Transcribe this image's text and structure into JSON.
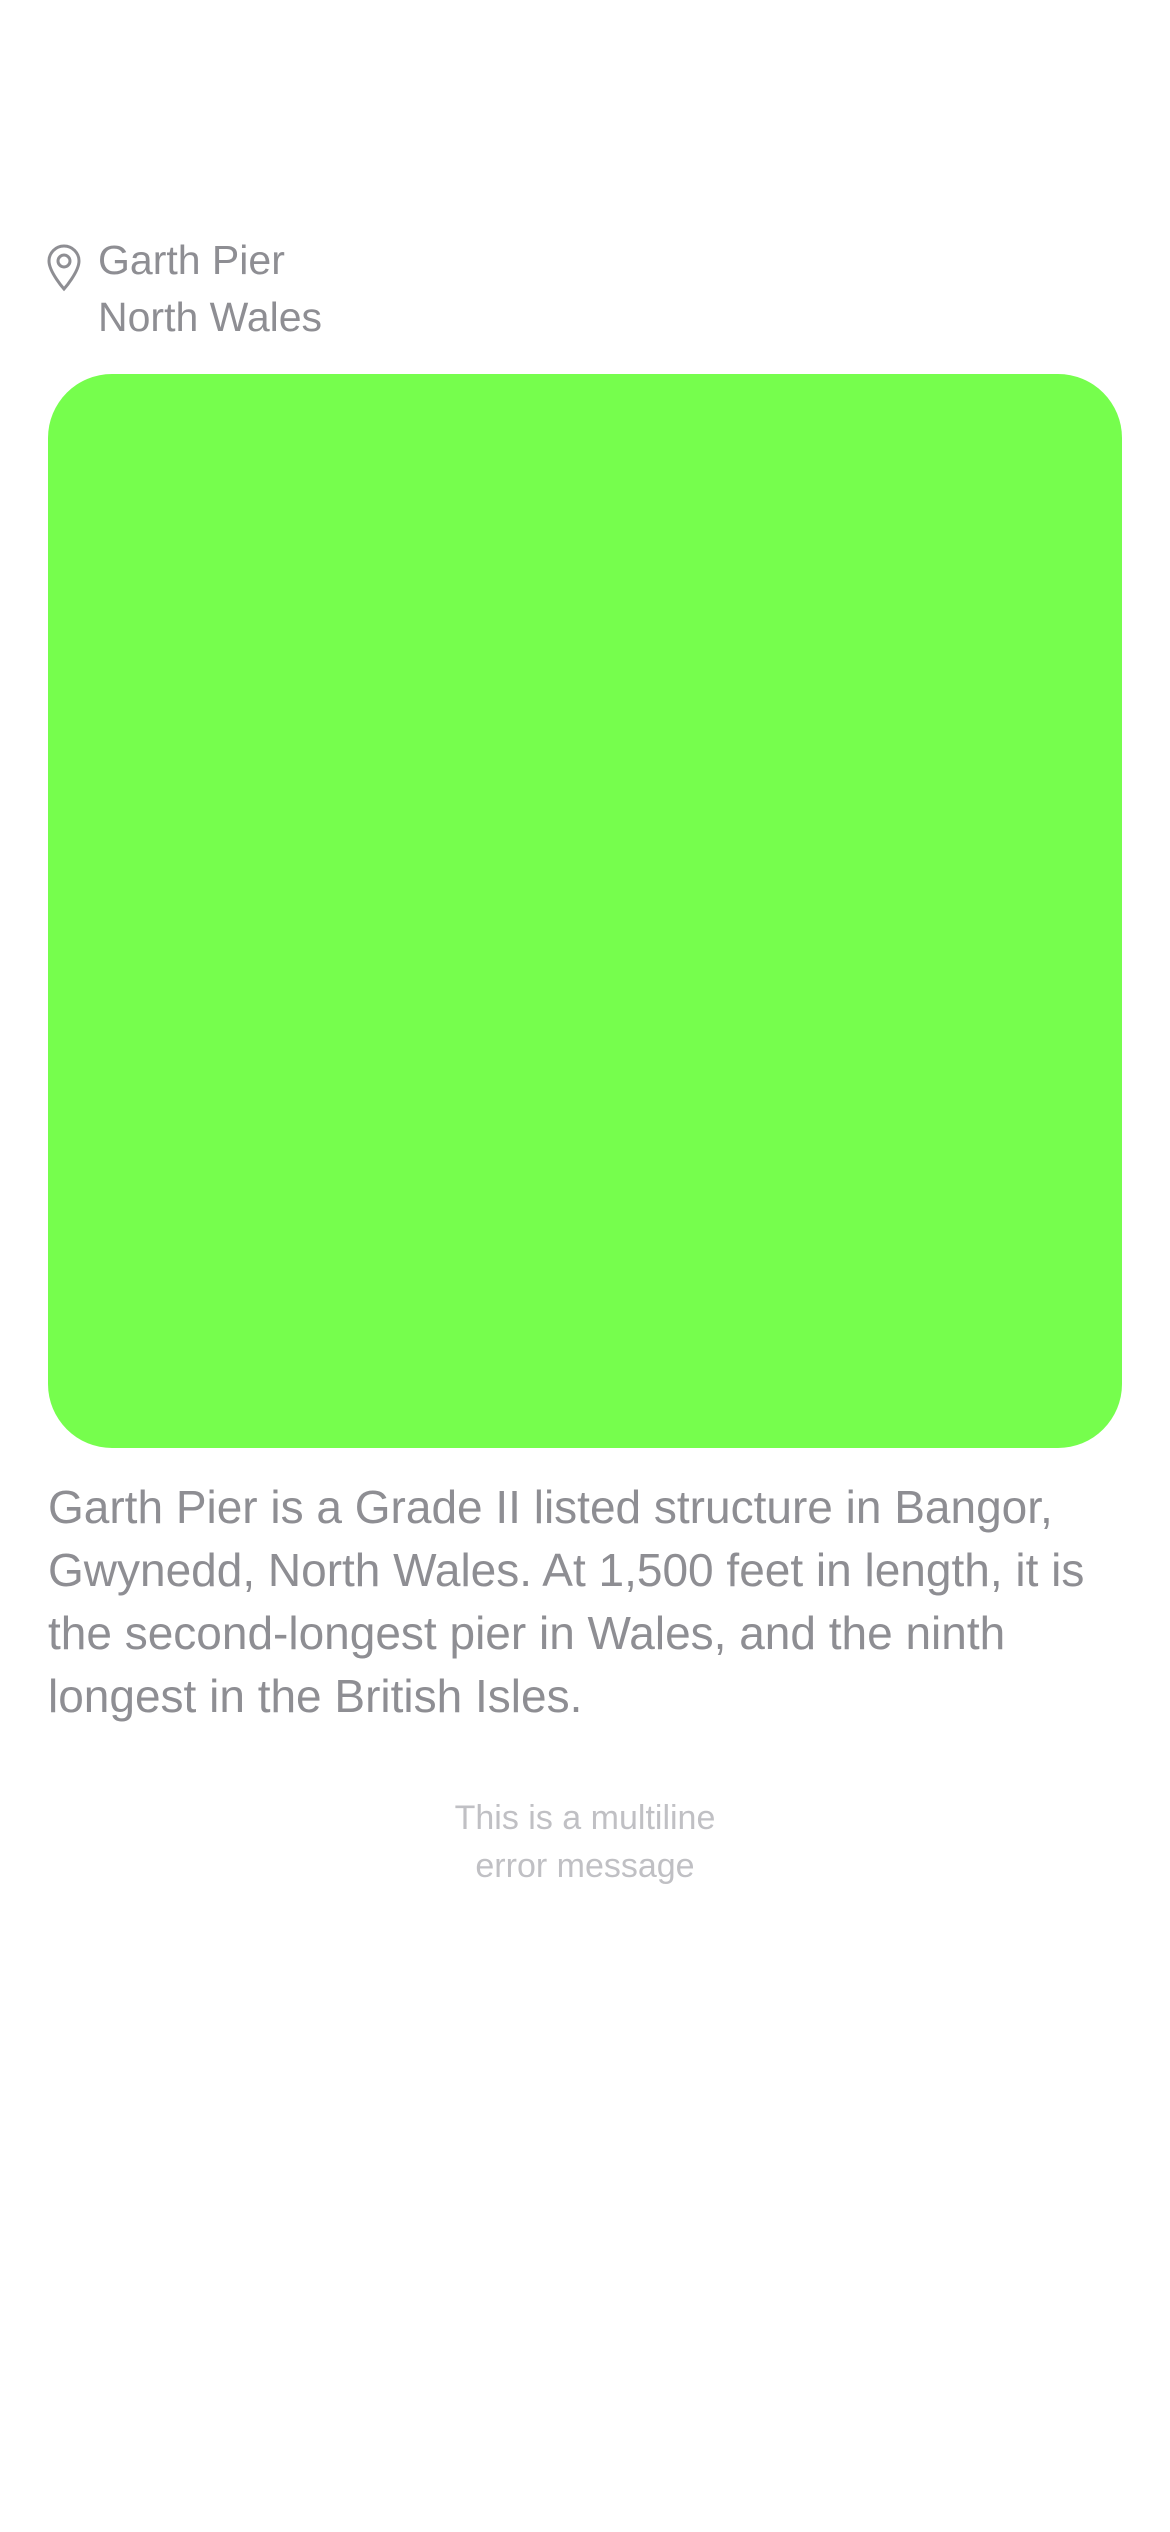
{
  "location": {
    "icon": "map-pin-icon",
    "name": "Garth Pier",
    "region": "North Wales"
  },
  "media": {
    "color": "#76fe4d"
  },
  "description": "Garth Pier is a Grade II listed structure in Bangor, Gwynedd, North Wales. At 1,500 feet in length, it is the second-longest pier in Wales, and the ninth longest in the British Isles.",
  "error": {
    "line1": "This is a multiline",
    "line2": "error message"
  },
  "colors": {
    "secondary_text": "#8e8e93",
    "tertiary_text": "#c0c0c4",
    "accent": "#76fe4d"
  }
}
